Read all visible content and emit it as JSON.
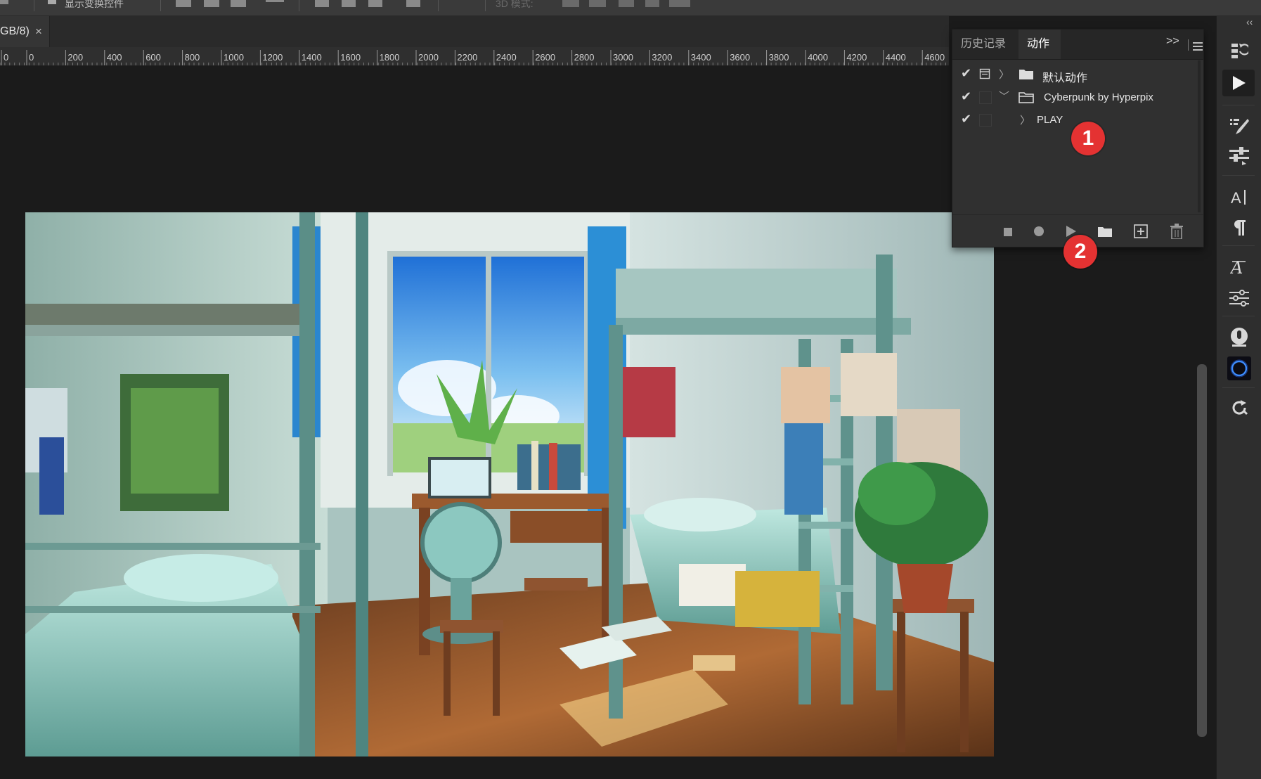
{
  "document": {
    "tab_label": "GB/8)",
    "close_glyph": "×"
  },
  "options_bar": {
    "show_transform_label": "显示变换控件",
    "mode_3d_label": "3D 模式:"
  },
  "ruler": {
    "labels": [
      "0",
      "0",
      "200",
      "400",
      "600",
      "800",
      "1000",
      "1200",
      "1400",
      "1600",
      "1800",
      "2000",
      "2200",
      "2400",
      "2600",
      "2800",
      "3000",
      "3200",
      "3400",
      "3600",
      "3800",
      "4000",
      "4200",
      "4400",
      "4600"
    ]
  },
  "actions_panel": {
    "tabs": [
      "历史记录",
      "动作"
    ],
    "active_tab": "动作",
    "expand_glyph": ">>",
    "rows": [
      {
        "label": "默认动作",
        "checked": true,
        "type": "set",
        "expanded": false
      },
      {
        "label": "Cyberpunk by Hyperpix",
        "checked": true,
        "type": "set",
        "expanded": true
      },
      {
        "label": "PLAY",
        "checked": true,
        "type": "action",
        "expanded": false
      }
    ],
    "footer_buttons": [
      "stop-icon",
      "record-icon",
      "play-icon",
      "folder-icon",
      "new-action-icon",
      "trash-icon"
    ]
  },
  "callouts": [
    {
      "number": "1",
      "color": "#e43232"
    },
    {
      "number": "2",
      "color": "#e43232"
    }
  ],
  "right_panel_icons": [
    "history-icon",
    "play-actions-icon",
    "brush-settings-icon",
    "adjust-sliders-icon",
    "character-icon",
    "paragraph-icon",
    "glyphs-icon",
    "properties-icon",
    "plugin-icon",
    "circle-app-icon",
    "refresh-icon"
  ],
  "colors": {
    "callout": "#e43232",
    "panel_bg": "#303030",
    "canvas_bg": "#1b1b1b",
    "accent_blue": "#1e6fbf"
  }
}
